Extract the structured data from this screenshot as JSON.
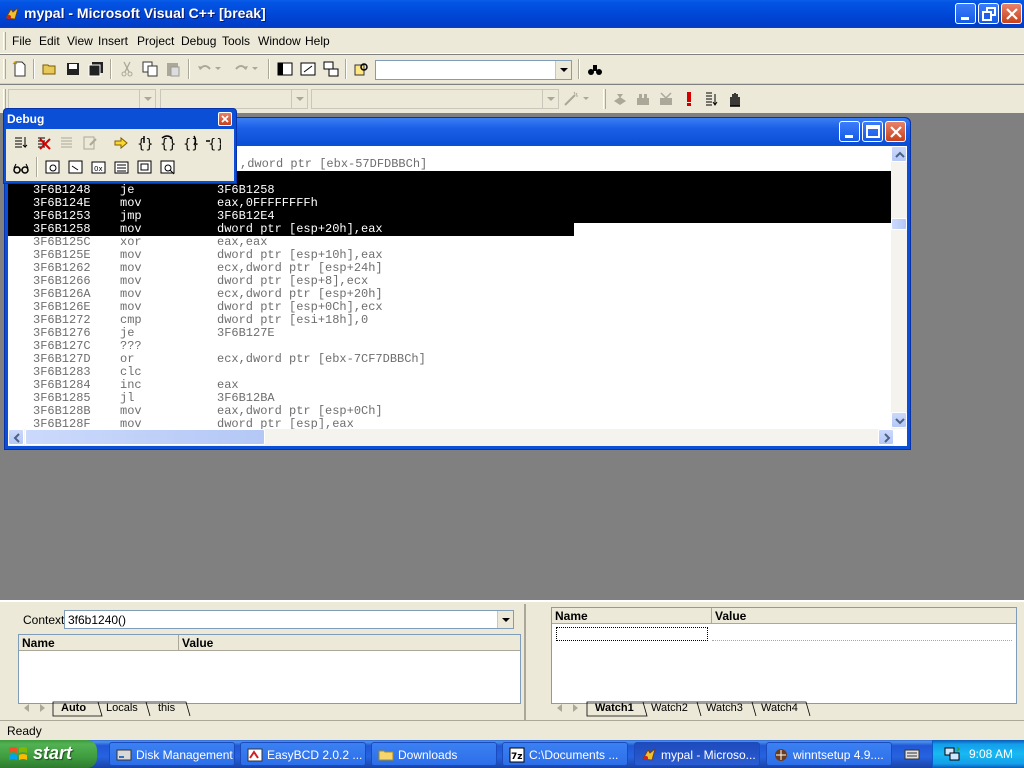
{
  "window": {
    "title": "mypal - Microsoft Visual C++ [break]"
  },
  "menu": [
    "File",
    "Edit",
    "View",
    "Insert",
    "Project",
    "Debug",
    "Tools",
    "Window",
    "Help"
  ],
  "debug_toolbar": {
    "title": "Debug"
  },
  "disassembly": {
    "lines": [
      {
        "addr": "",
        "op": "",
        "args": ",dword ptr [ebx-57DFDBBCh]",
        "state": "partial-top"
      },
      {
        "addr": "",
        "op": "",
        "args": "",
        "state": "selected"
      },
      {
        "addr": "3F6B1248",
        "op": "je",
        "args": "3F6B1258",
        "state": "selected"
      },
      {
        "addr": "3F6B124E",
        "op": "mov",
        "args": "eax,0FFFFFFFFh",
        "state": "selected"
      },
      {
        "addr": "3F6B1253",
        "op": "jmp",
        "args": "3F6B12E4",
        "state": "selected"
      },
      {
        "addr": "3F6B1258",
        "op": "mov",
        "args": "dword ptr [esp+20h],eax",
        "state": "selected-partial"
      },
      {
        "addr": "3F6B125C",
        "op": "xor",
        "args": "eax,eax",
        "state": "normal"
      },
      {
        "addr": "3F6B125E",
        "op": "mov",
        "args": "dword ptr [esp+10h],eax",
        "state": "normal"
      },
      {
        "addr": "3F6B1262",
        "op": "mov",
        "args": "ecx,dword ptr [esp+24h]",
        "state": "normal"
      },
      {
        "addr": "3F6B1266",
        "op": "mov",
        "args": "dword ptr [esp+8],ecx",
        "state": "normal"
      },
      {
        "addr": "3F6B126A",
        "op": "mov",
        "args": "ecx,dword ptr [esp+20h]",
        "state": "normal"
      },
      {
        "addr": "3F6B126E",
        "op": "mov",
        "args": "dword ptr [esp+0Ch],ecx",
        "state": "normal"
      },
      {
        "addr": "3F6B1272",
        "op": "cmp",
        "args": "dword ptr [esi+18h],0",
        "state": "normal"
      },
      {
        "addr": "3F6B1276",
        "op": "je",
        "args": "3F6B127E",
        "state": "normal"
      },
      {
        "addr": "3F6B127C",
        "op": "???",
        "args": "",
        "state": "normal"
      },
      {
        "addr": "3F6B127D",
        "op": "or",
        "args": "ecx,dword ptr [ebx-7CF7DBBCh]",
        "state": "normal"
      },
      {
        "addr": "3F6B1283",
        "op": "clc",
        "args": "",
        "state": "normal"
      },
      {
        "addr": "3F6B1284",
        "op": "inc",
        "args": "eax",
        "state": "normal"
      },
      {
        "addr": "3F6B1285",
        "op": "jl",
        "args": "3F6B12BA",
        "state": "normal"
      },
      {
        "addr": "3F6B128B",
        "op": "mov",
        "args": "eax,dword ptr [esp+0Ch]",
        "state": "normal"
      },
      {
        "addr": "3F6B128F",
        "op": "mov",
        "args": "dword ptr [esp],eax",
        "state": "normal"
      }
    ]
  },
  "variables_pane": {
    "context_label": "Context:",
    "context_value": "3f6b1240()",
    "columns": [
      "Name",
      "Value"
    ],
    "tabs": [
      "Auto",
      "Locals",
      "this"
    ],
    "active_tab": "Auto"
  },
  "watch_pane": {
    "columns": [
      "Name",
      "Value"
    ],
    "tabs": [
      "Watch1",
      "Watch2",
      "Watch3",
      "Watch4"
    ],
    "active_tab": "Watch1"
  },
  "status": {
    "text": "Ready"
  },
  "taskbar": {
    "start_label": "start",
    "items": [
      {
        "label": "Disk Management",
        "icon": "disk-management-icon",
        "active": false
      },
      {
        "label": "EasyBCD 2.0.2 ...",
        "icon": "easybcd-icon",
        "active": false
      },
      {
        "label": "Downloads",
        "icon": "folder-icon",
        "active": false
      },
      {
        "label": "C:\\Documents ...",
        "icon": "7zip-icon",
        "active": false
      },
      {
        "label": "mypal - Microso...",
        "icon": "visual-cpp-icon",
        "active": true
      },
      {
        "label": "winntsetup 4.9....",
        "icon": "winntsetup-icon",
        "active": false
      }
    ],
    "clock": "9:08 AM"
  }
}
